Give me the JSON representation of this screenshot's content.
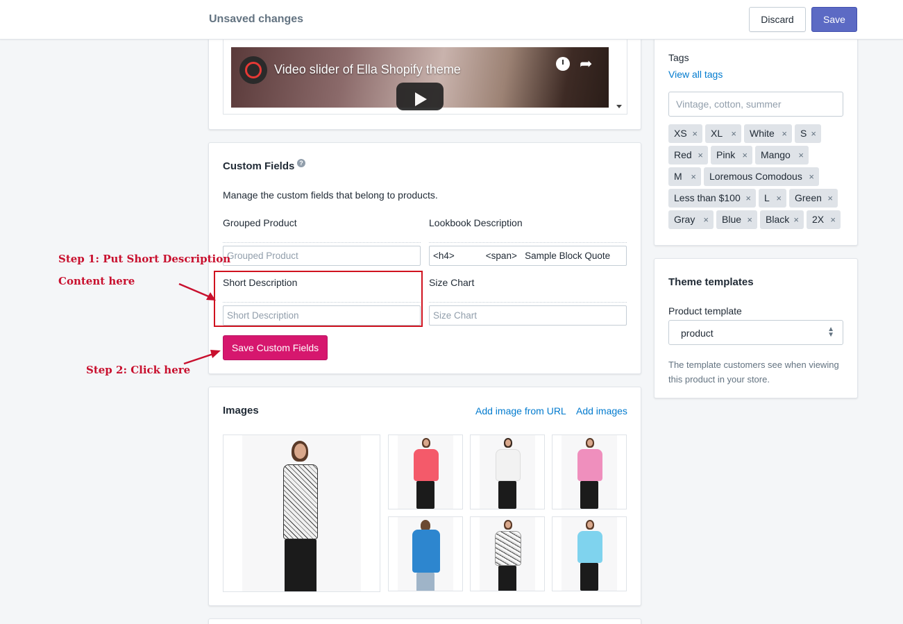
{
  "topbar": {
    "title": "Unsaved changes",
    "discard_label": "Discard",
    "save_label": "Save"
  },
  "video": {
    "title": "Video slider of Ella Shopify theme",
    "icons": [
      "video-channel-logo-icon",
      "clock-icon",
      "share-icon",
      "play-icon"
    ]
  },
  "custom_fields": {
    "title": "Custom Fields",
    "help_glyph": "?",
    "description": "Manage the custom fields that belong to products.",
    "fields": [
      {
        "label": "Grouped Product",
        "value": "",
        "placeholder": "Grouped Product"
      },
      {
        "label": "Lookbook Description",
        "value": "<h4>            <span>   Sample Block Quote",
        "placeholder": ""
      },
      {
        "label": "Short Description",
        "value": "",
        "placeholder": "Short Description"
      },
      {
        "label": "Size Chart",
        "value": "",
        "placeholder": "Size Chart"
      }
    ],
    "save_label": "Save Custom Fields"
  },
  "annotations": {
    "step1_line1": "Step 1: Put Short Description",
    "step1_line2": "Content here",
    "step2": "Step 2: Click here",
    "color": "#c8102e"
  },
  "images": {
    "title": "Images",
    "add_from_url": "Add image from URL",
    "add_images": "Add images",
    "items": [
      {
        "name": "printed sleeveless blouse",
        "color": "#e8e4e0"
      },
      {
        "name": "coral top",
        "color": "#f45a6a"
      },
      {
        "name": "white sheer top",
        "color": "#f2f2f2"
      },
      {
        "name": "pink top",
        "color": "#ef8fbd"
      },
      {
        "name": "blue hoodie",
        "color": "#2d86cf"
      },
      {
        "name": "printed blouse",
        "color": "#d8d8d8"
      },
      {
        "name": "light blue top",
        "color": "#7fd3ee"
      }
    ]
  },
  "tags": {
    "label": "Tags",
    "view_all": "View all tags",
    "placeholder": "Vintage, cotton, summer",
    "items": [
      "XS",
      "XL",
      "White",
      "S",
      "Red",
      "Pink",
      "Mango",
      "M",
      "Loremous Comodous",
      "Less than $100",
      "L",
      "Green",
      "Gray",
      "Blue",
      "Black",
      "2X"
    ],
    "remove_glyph": "×"
  },
  "theme": {
    "title": "Theme templates",
    "product_template_label": "Product template",
    "selected": "product",
    "select_glyph": "▲▼",
    "help": "The template customers see when viewing this product in your store."
  },
  "colors": {
    "primary": "#5c6ac4",
    "accent_pink": "#d6176e",
    "link": "#007ace",
    "annotation_red": "#c8102e"
  }
}
